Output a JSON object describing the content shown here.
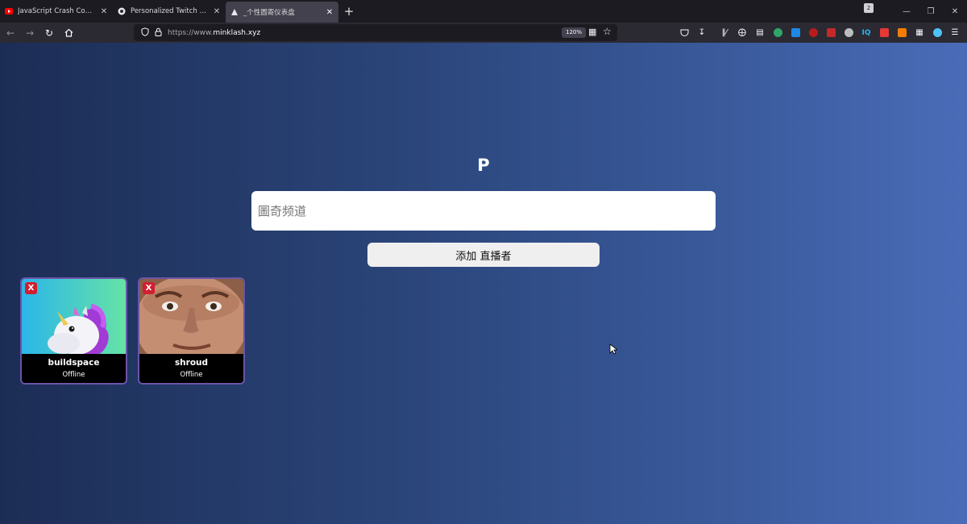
{
  "browser": {
    "tabs": [
      {
        "title": "JavaScript Crash Course For Beginners",
        "active": false
      },
      {
        "title": "Personalized Twitch Dashboard",
        "active": false
      },
      {
        "title": "_个性圖寄仪表盘",
        "active": true
      }
    ],
    "close_glyph": "✕",
    "new_tab_glyph": "+",
    "url_prefix": "https://www.",
    "url_domain": "minklash.xyz",
    "zoom": "120%",
    "tray_badge": "2"
  },
  "page": {
    "title": "P",
    "search_placeholder": "圖奇频道",
    "add_button": "添加 直播者",
    "remove_label": "X",
    "streamers": [
      {
        "name": "buildspace",
        "status": "Offline"
      },
      {
        "name": "shroud",
        "status": "Offline"
      }
    ]
  },
  "colors": {
    "gradient_start": "#1c2d55",
    "gradient_end": "#4a6cb8",
    "card_border": "#6a55a8",
    "remove_button": "#d01f31"
  }
}
